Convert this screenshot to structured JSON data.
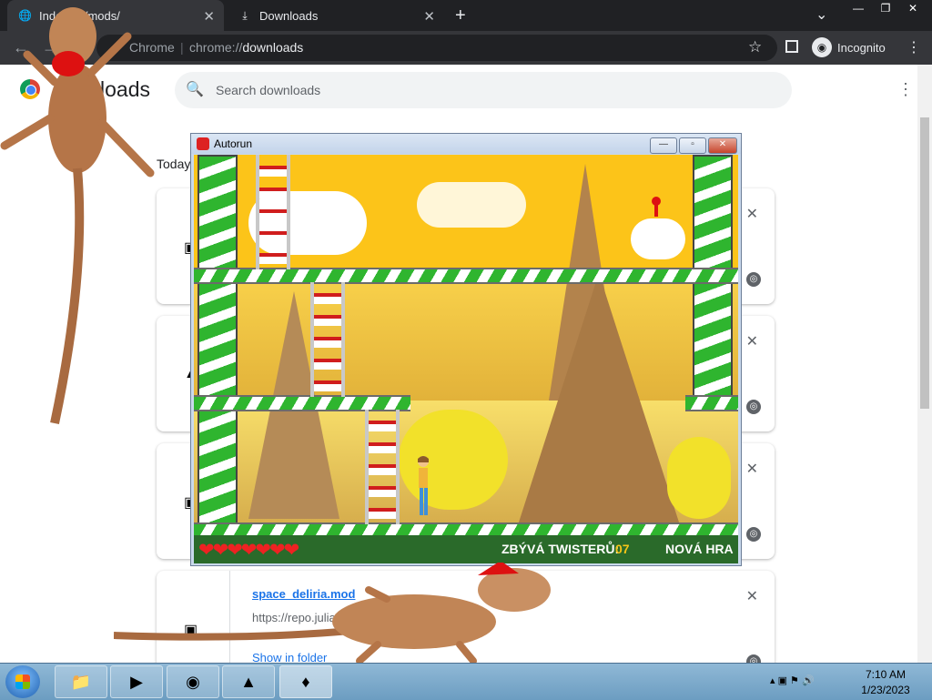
{
  "browser": {
    "tabs": [
      {
        "title": "Index of /mods/"
      },
      {
        "title": "Downloads"
      }
    ],
    "omnibox": {
      "chip": "Chrome",
      "scheme": "chrome://",
      "host": "downloads"
    },
    "incognito_label": "Incognito"
  },
  "downloads": {
    "title_fragment": "loads",
    "search_placeholder": "Search downloads",
    "today_label": "Today",
    "items": [
      {
        "filename": "",
        "url": "",
        "show_label": ""
      },
      {
        "filename": "",
        "url": "",
        "show_label": ""
      },
      {
        "filename": "",
        "url": "",
        "show_label": ""
      },
      {
        "filename": "space_deliria.mod",
        "url": "https://repo.julias.zone/m",
        "show_label": "Show in folder"
      }
    ]
  },
  "autorun": {
    "window_title": "Autorun",
    "lives": 7,
    "hearts": "❤❤❤❤❤❤❤",
    "remaining_label": "ZBÝVÁ TWISTERŮ:",
    "remaining_value": "07",
    "new_game_label": "NOVÁ HRA"
  },
  "taskbar": {
    "clock_time": "7:10 AM",
    "clock_date": "1/23/2023"
  },
  "colors": {
    "chrome_dark": "#202124",
    "game_yellow": "#f7c521",
    "candy_green": "#2fb52f",
    "ladder_red": "#d01d1d"
  }
}
